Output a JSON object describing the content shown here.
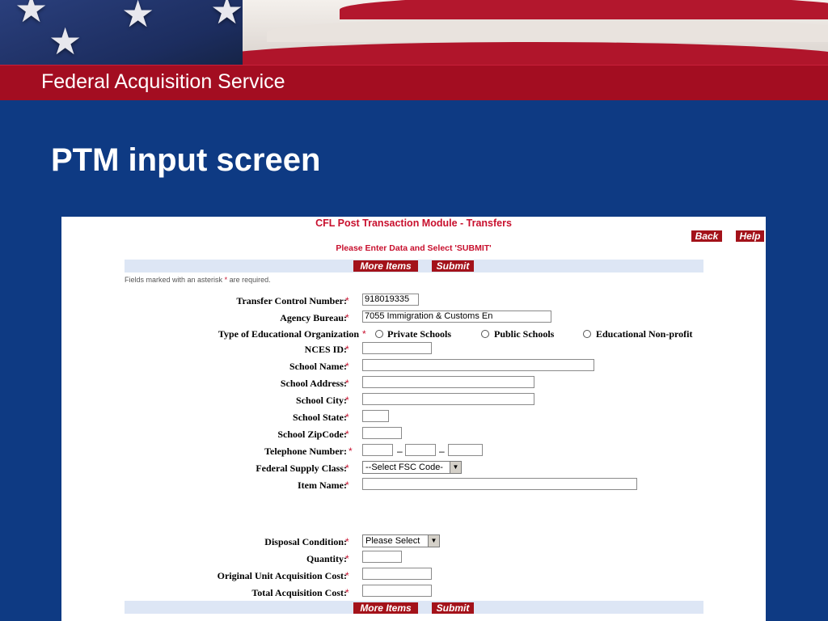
{
  "header": {
    "service": "Federal Acquisition Service",
    "slide_title": "PTM input screen"
  },
  "form": {
    "title": "CFL Post Transaction Module - Transfers",
    "instruction": "Please Enter Data and Select 'SUBMIT'",
    "back_label": "Back",
    "help_label": "Help",
    "more_items_label": "More Items",
    "submit_label": "Submit",
    "required_note_pre": "Fields marked with an asterisk",
    "required_note_ast": "*",
    "required_note_post": "are required.",
    "asterisk": "*",
    "fields": {
      "transfer_control_number": {
        "label": "Transfer Control Number:",
        "value": "918019335"
      },
      "agency_bureau": {
        "label": "Agency Bureau:",
        "value": "7055  Immigration & Customs En"
      },
      "org_type": {
        "label": "Type of Educational Organization",
        "options": [
          "Private Schools",
          "Public Schools",
          "Educational Non-profit"
        ]
      },
      "nces_id": {
        "label": "NCES ID:",
        "value": ""
      },
      "school_name": {
        "label": "School Name:",
        "value": ""
      },
      "school_address": {
        "label": "School Address:",
        "value": ""
      },
      "school_city": {
        "label": "School City:",
        "value": ""
      },
      "school_state": {
        "label": "School State:",
        "value": ""
      },
      "school_zipcode": {
        "label": "School ZipCode:",
        "value": ""
      },
      "telephone": {
        "label": "Telephone Number:",
        "separator": "–"
      },
      "federal_supply_class": {
        "label": "Federal Supply Class:",
        "selected": "--Select FSC Code-"
      },
      "item_name": {
        "label": "Item Name:",
        "value": ""
      },
      "disposal_condition": {
        "label": "Disposal Condition:",
        "selected": "Please Select"
      },
      "quantity": {
        "label": "Quantity:",
        "value": ""
      },
      "original_unit_cost": {
        "label": "Original Unit Acquisition Cost:",
        "value": ""
      },
      "total_cost": {
        "label": "Total Acquisition Cost:",
        "value": ""
      }
    }
  },
  "colors": {
    "slide_background": "#0e3a83",
    "red_bar": "#a30d21",
    "form_red": "#c8102e",
    "button_bar": "#dde6f5"
  }
}
